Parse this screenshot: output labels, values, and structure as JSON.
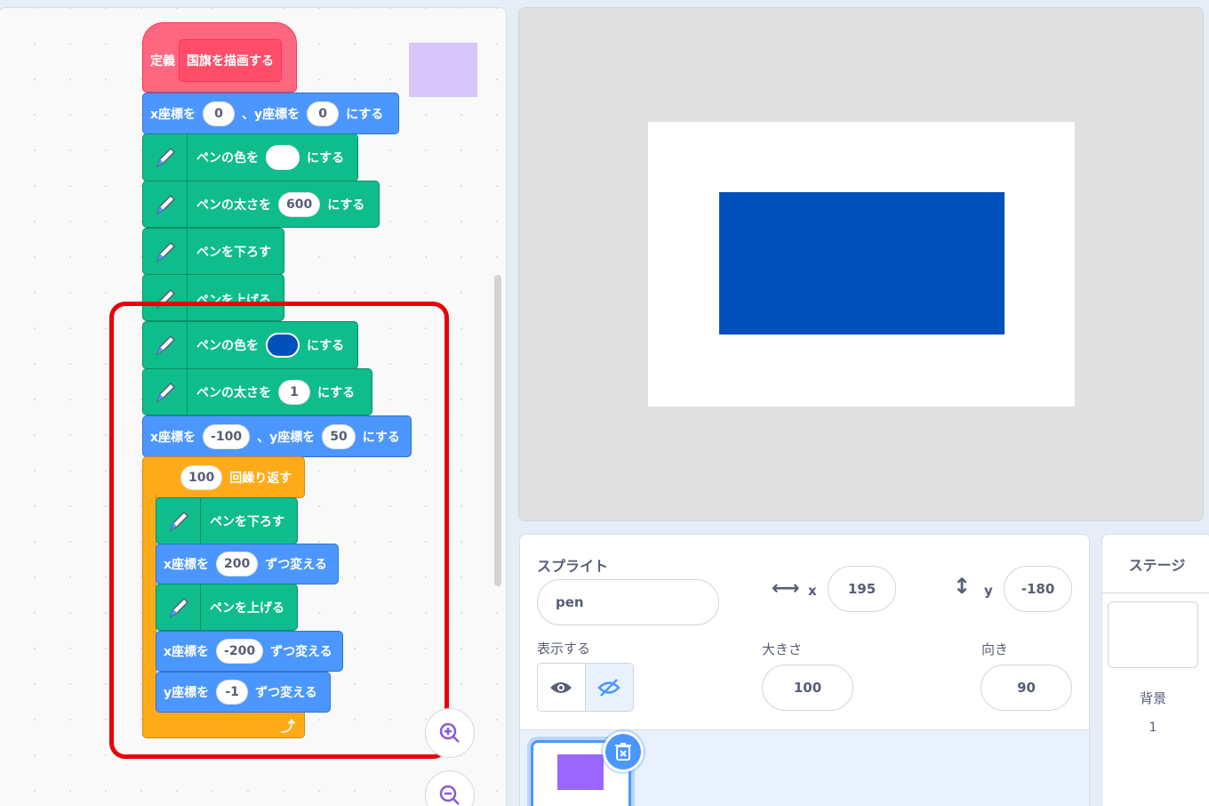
{
  "code": {
    "define_label": "定義",
    "define_name": "国旗を描画する",
    "goto1": {
      "x_label": "x座標を",
      "x": "0",
      "sep": "、y座標を",
      "y": "0",
      "end": "にする"
    },
    "pen_color1": {
      "label": "ペンの色を",
      "end": "にする",
      "color": "#ffffff"
    },
    "pen_size1": {
      "label": "ペンの太さを",
      "value": "600",
      "end": "にする"
    },
    "pen_down1": "ペンを下ろす",
    "pen_up_hidden": "ペンを上げる",
    "pen_color2": {
      "label": "ペンの色を",
      "end": "にする",
      "color": "#0050bb"
    },
    "pen_size2": {
      "label": "ペンの太さを",
      "value": "1",
      "end": "にする"
    },
    "goto2": {
      "x_label": "x座標を",
      "x": "-100",
      "sep": "、y座標を",
      "y": "50",
      "end": "にする"
    },
    "repeat": {
      "count": "100",
      "label": "回繰り返す"
    },
    "inner": {
      "pen_down": "ペンを下ろす",
      "change_x1": {
        "label": "x座標を",
        "value": "200",
        "end": "ずつ変える"
      },
      "pen_up": "ペンを上げる",
      "change_x2": {
        "label": "x座標を",
        "value": "-200",
        "end": "ずつ変える"
      },
      "change_y": {
        "label": "y座標を",
        "value": "-1",
        "end": "ずつ変える"
      }
    },
    "highlight_color": "#e8000b"
  },
  "stage": {
    "background": "#ffffff",
    "rect_color": "#0050bb"
  },
  "sprite_info": {
    "title": "スプライト",
    "name": "pen",
    "x_label": "x",
    "x": "195",
    "y_label": "y",
    "y": "-180",
    "show_label": "表示する",
    "size_label": "大きさ",
    "size": "100",
    "direction_label": "向き",
    "direction": "90",
    "costume_color": "#9966ff"
  },
  "stage_panel": {
    "title": "ステージ",
    "backdrop_label": "背景",
    "backdrop_count": "1"
  }
}
